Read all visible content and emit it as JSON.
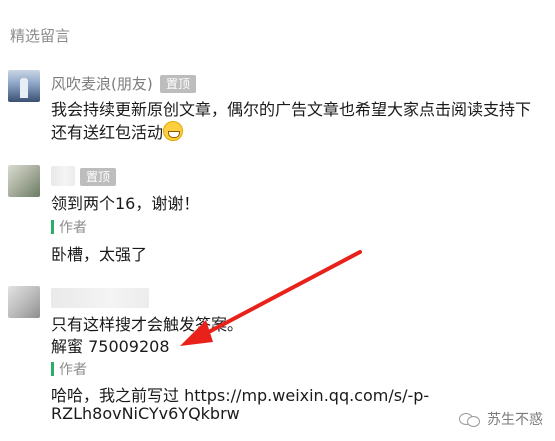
{
  "section_title": "精选留言",
  "comments": [
    {
      "nickname": "风吹麦浪(朋友)",
      "badge": "置顶",
      "lines": [
        "我会持续更新原创文章，偶尔的广告文章也希望大家点击阅读支持下",
        "还有送红包活动"
      ],
      "emoji": "grin-emoji"
    },
    {
      "nickname": "",
      "badge": "置顶",
      "lines": [
        "领到两个16，谢谢！"
      ],
      "reply": {
        "label": "作者",
        "text": "卧槽，太强了"
      }
    },
    {
      "nickname": "",
      "lines": [
        "只有这样搜才会触发答案。",
        "解蜜 75009208"
      ],
      "reply": {
        "label": "作者",
        "lines": [
          "哈哈，我之前写过 https://mp.weixin.qq.com/s/-p-",
          "RZLh8ovNiCYv6YQkbrw"
        ]
      }
    }
  ],
  "watermark": "苏生不惑",
  "colors": {
    "arrow": "#e8221b",
    "author_bar": "#2aae67",
    "badge_bg": "#bdbdbd"
  }
}
